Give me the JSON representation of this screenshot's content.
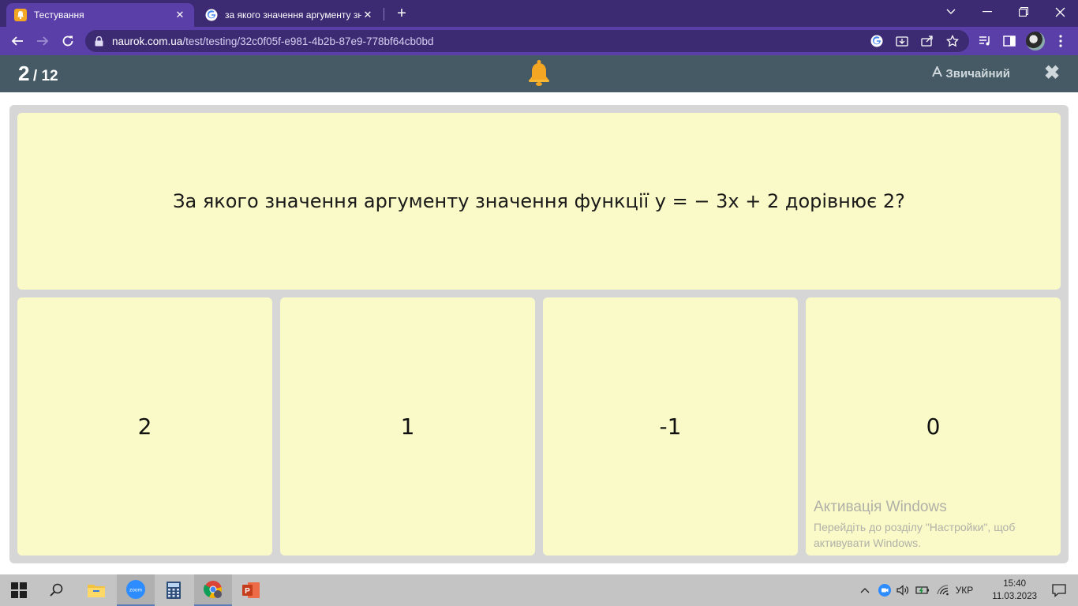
{
  "browser": {
    "tabs": [
      {
        "title": "Тестування",
        "active": true,
        "icon": "bell-favicon"
      },
      {
        "title": "за якого значення аргументу значення",
        "active": false,
        "icon": "google-favicon"
      }
    ],
    "address": {
      "host": "naurok.com.ua",
      "path": "/test/testing/32c0f05f-e981-4b2b-87e9-778bf64cb0bd"
    },
    "theme_color": "#5a3fa8"
  },
  "header": {
    "current": "2",
    "total": "/ 12",
    "mode_label": "Звичайний",
    "bar_color": "#455a64"
  },
  "question": {
    "text": "За якого значення аргументу значення функції у = − 3х + 2 дорівнює 2?"
  },
  "options": [
    "2",
    "1",
    "-1",
    "0"
  ],
  "watermark": {
    "title": "Активація Windows",
    "line1": "Перейдіть до розділу \"Настройки\", щоб",
    "line2": "активувати Windows."
  },
  "taskbar": {
    "language": "УКР",
    "time": "15:40",
    "date": "11.03.2023",
    "apps": [
      "start-icon",
      "search-icon",
      "file-explorer-icon",
      "zoom-icon",
      "calculator-icon",
      "chrome-icon",
      "powerpoint-icon"
    ]
  }
}
